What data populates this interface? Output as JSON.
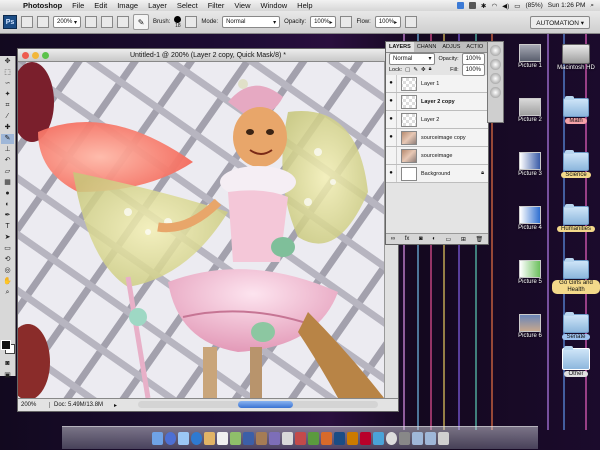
{
  "menubar": {
    "app": "Photoshop",
    "items": [
      "File",
      "Edit",
      "Image",
      "Layer",
      "Select",
      "Filter",
      "View",
      "Window",
      "Help"
    ],
    "battery": "(85%)",
    "clock": "Sun 1:26 PM"
  },
  "options": {
    "zoom": "200%",
    "brush_label": "Brush:",
    "brush_size": "18",
    "mode_label": "Mode:",
    "mode_value": "Normal",
    "opacity_label": "Opacity:",
    "opacity_value": "100%",
    "flow_label": "Flow:",
    "flow_value": "100%",
    "workspace": "AUTOMATION ▾"
  },
  "document": {
    "title": "Untitled-1 @ 200% (Layer 2 copy, Quick Mask/8) *",
    "status_zoom": "200%",
    "status_doc": "Doc: 5.49M/13.8M"
  },
  "layers_panel": {
    "tabs": [
      "LAYERS",
      "CHANN",
      "ADJUS",
      "ACTIO"
    ],
    "blend_mode": "Normal",
    "opacity_label": "Opacity:",
    "opacity_value": "100%",
    "lock_label": "Lock:",
    "fill_label": "Fill:",
    "fill_value": "100%",
    "layers": [
      {
        "name": "Layer 1",
        "visible": true
      },
      {
        "name": "Layer 2 copy",
        "visible": true
      },
      {
        "name": "Layer 2",
        "visible": true
      },
      {
        "name": "sourceimage copy",
        "visible": true
      },
      {
        "name": "sourceimage",
        "visible": false
      },
      {
        "name": "Background",
        "visible": true
      }
    ]
  },
  "desktop": {
    "items": [
      {
        "label": "Picture 1",
        "kind": "picture"
      },
      {
        "label": "Macintosh HD",
        "kind": "drive"
      },
      {
        "label": "Picture 2",
        "kind": "picture"
      },
      {
        "label": "Math",
        "kind": "folder",
        "color": "#f5a3a8"
      },
      {
        "label": "Picture 3",
        "kind": "picture"
      },
      {
        "label": "Science",
        "kind": "folder",
        "color": "#f3d98a"
      },
      {
        "label": "Picture 4",
        "kind": "picture"
      },
      {
        "label": "Humanities",
        "kind": "folder",
        "color": "#f3d98a"
      },
      {
        "label": "Picture 5",
        "kind": "picture"
      },
      {
        "label": "Go Girls and Health",
        "kind": "folder",
        "color": "#f3d98a"
      },
      {
        "label": "Picture 6",
        "kind": "picture"
      },
      {
        "label": "Senate",
        "kind": "folder",
        "color": "#9fc3f0"
      },
      {
        "label": "Other",
        "kind": "folder",
        "color": "#e0e0e0"
      }
    ]
  }
}
